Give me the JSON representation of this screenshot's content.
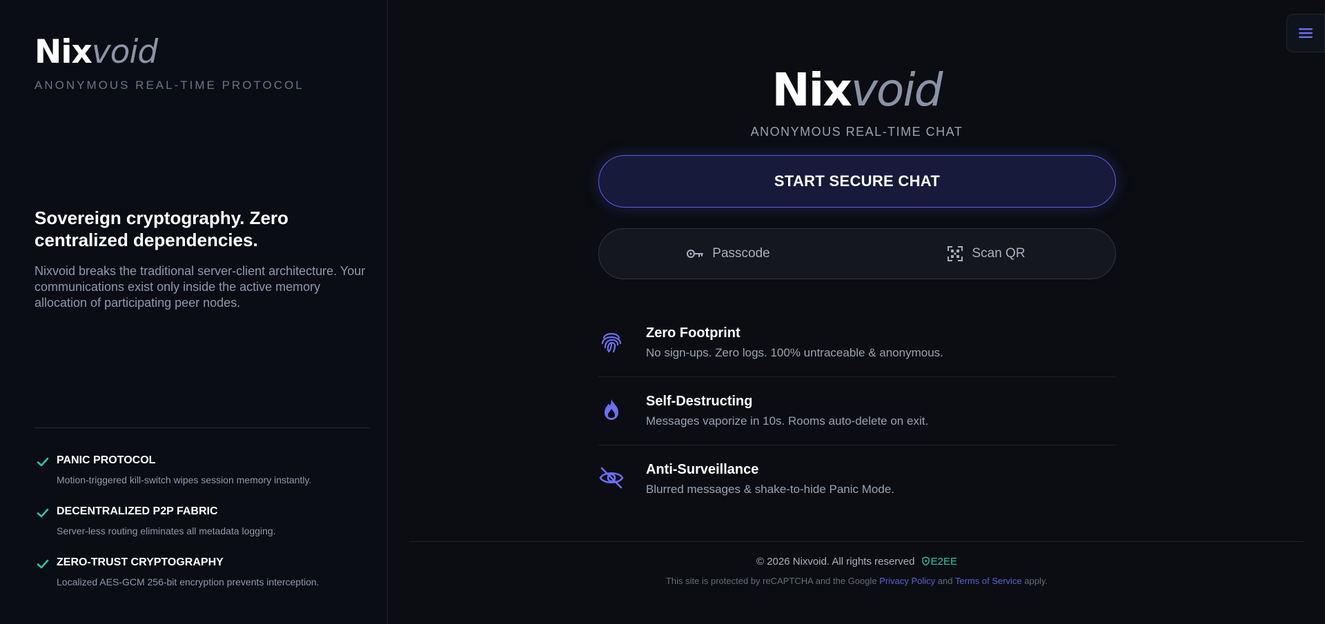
{
  "brand": {
    "name_part1": "Nix",
    "name_part2": "void"
  },
  "sidebar": {
    "tagline": "ANONYMOUS REAL-TIME PROTOCOL",
    "hero_title": "Sovereign cryptography. Zero centralized dependencies.",
    "hero_text": "Nixvoid breaks the traditional server-client architecture. Your communications exist only inside the active memory allocation of participating peer nodes.",
    "features": [
      {
        "title": "PANIC PROTOCOL",
        "desc": "Motion-triggered kill-switch wipes session memory instantly.",
        "icon": "check-icon"
      },
      {
        "title": "DECENTRALIZED P2P FABRIC",
        "desc": "Server-less routing eliminates all metadata logging.",
        "icon": "check-icon"
      },
      {
        "title": "ZERO-TRUST CRYPTOGRAPHY",
        "desc": "Localized AES-GCM 256-bit encryption prevents interception.",
        "icon": "check-icon"
      }
    ]
  },
  "main": {
    "tagline": "ANONYMOUS REAL-TIME CHAT",
    "start_button": "START SECURE CHAT",
    "passcode_button": "Passcode",
    "scan_button": "Scan QR",
    "features": [
      {
        "title": "Zero Footprint",
        "desc": "No sign-ups. Zero logs. 100% untraceable & anonymous.",
        "icon": "fingerprint-icon"
      },
      {
        "title": "Self-Destructing",
        "desc": "Messages vaporize in 10s. Rooms auto-delete on exit.",
        "icon": "flame-icon"
      },
      {
        "title": "Anti-Surveillance",
        "desc": "Blurred messages & shake-to-hide Panic Mode.",
        "icon": "eye-off-icon"
      }
    ]
  },
  "footer": {
    "copyright": "© 2026 Nixvoid. All rights reserved",
    "badge": "E2EE",
    "recaptcha_prefix": "This site is protected by reCAPTCHA and the Google",
    "privacy_link": "Privacy Policy",
    "and_text": "and",
    "terms_link": "Terms of Service",
    "suffix": "apply."
  },
  "colors": {
    "background": "#0b0d12",
    "accent": "#5b5ee0",
    "success": "#2fc4a8",
    "text_muted": "#8f98ab"
  }
}
